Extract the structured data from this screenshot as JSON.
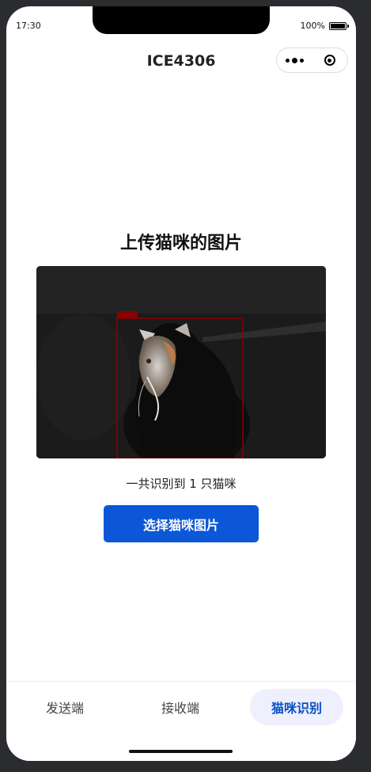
{
  "status": {
    "time": "17:30",
    "battery": "100%"
  },
  "nav": {
    "title": "ICE4306"
  },
  "main": {
    "title": "上传猫咪的图片",
    "result_text": "一共识别到 1 只猫咪",
    "pick_button": "选择猫咪图片"
  },
  "tabs": [
    {
      "label": "发送端"
    },
    {
      "label": "接收端"
    },
    {
      "label": "猫咪识别"
    }
  ],
  "colors": {
    "accent": "#0b57d8",
    "active_tab_bg": "#eef0fd",
    "detection_box": "#8b0000"
  },
  "icons": {
    "more": "more-dots-icon",
    "close": "record-close-icon",
    "battery": "battery-icon"
  }
}
